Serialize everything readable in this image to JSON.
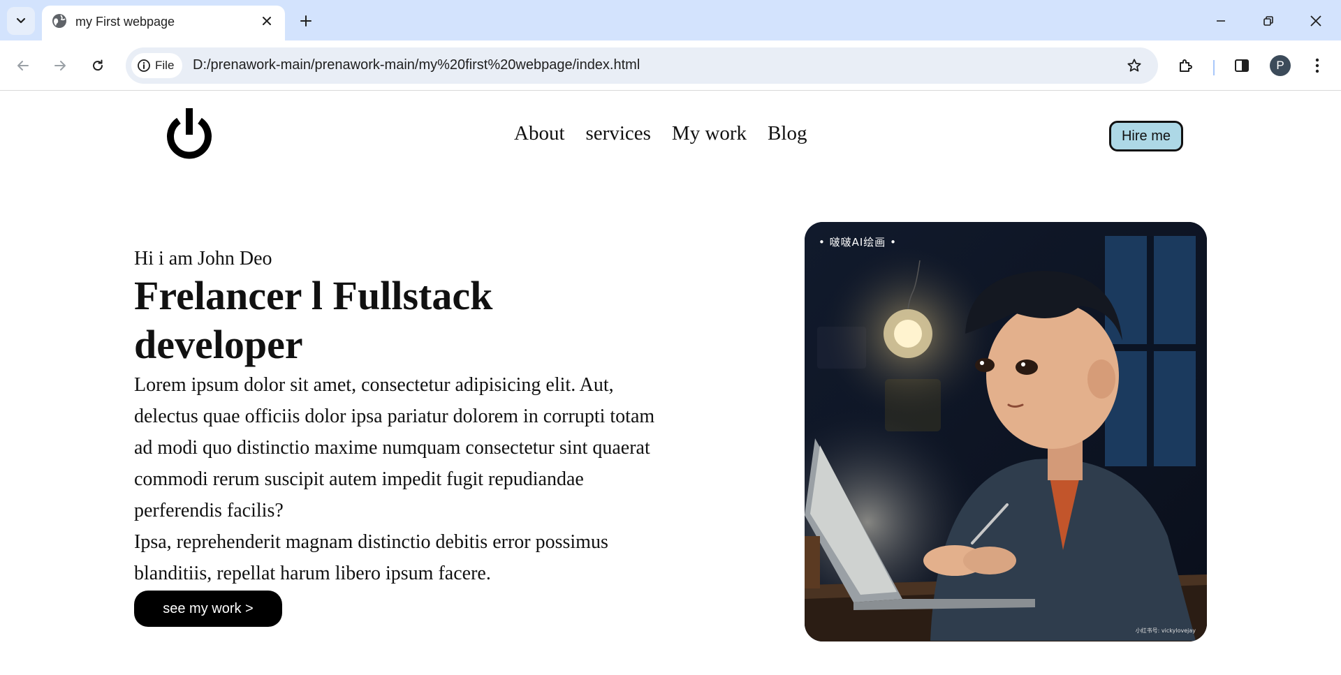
{
  "browser": {
    "tab_title": "my First webpage",
    "address_chip": "File",
    "url": "D:/prenawork-main/prenawork-main/my%20first%20webpage/index.html",
    "profile_initial": "P",
    "icons": [
      "tab-search-icon",
      "globe-icon",
      "close-icon",
      "plus-icon",
      "minimize-icon",
      "restore-icon",
      "window-close-icon",
      "back-arrow-icon",
      "forward-arrow-icon",
      "reload-icon",
      "info-icon",
      "star-icon",
      "extensions-icon",
      "side-panel-icon",
      "more-vert-icon"
    ]
  },
  "site": {
    "logo_icon": "power-icon",
    "nav": [
      "About",
      "services",
      "My work",
      "Blog"
    ],
    "hire_label": "Hire me",
    "greeting": "Hi i am John Deo",
    "headline": "Frelancer l Fullstack developer",
    "paragraph1": "Lorem ipsum dolor sit amet, consectetur adipisicing elit. Aut, delectus quae officiis dolor ipsa pariatur dolorem in corrupti totam ad modi quo distinctio maxime numquam consectetur sint quaerat commodi rerum suscipit autem impedit fugit repudiandae perferendis facilis?",
    "paragraph2": "Ipsa, reprehenderit magnam distinctio debitis error possimus blanditiis, repellat harum libero ipsum facere.",
    "cta_label": "see my work >",
    "hero_image": {
      "watermark_top": "• 啵啵AI绘画 •",
      "watermark_bottom": "小红书号: vickylovejay"
    }
  },
  "colors": {
    "tabstrip": "#d3e3fd",
    "omnibox": "#e9eef6",
    "hire_button": "#add8e6",
    "cta_button": "#000000"
  }
}
